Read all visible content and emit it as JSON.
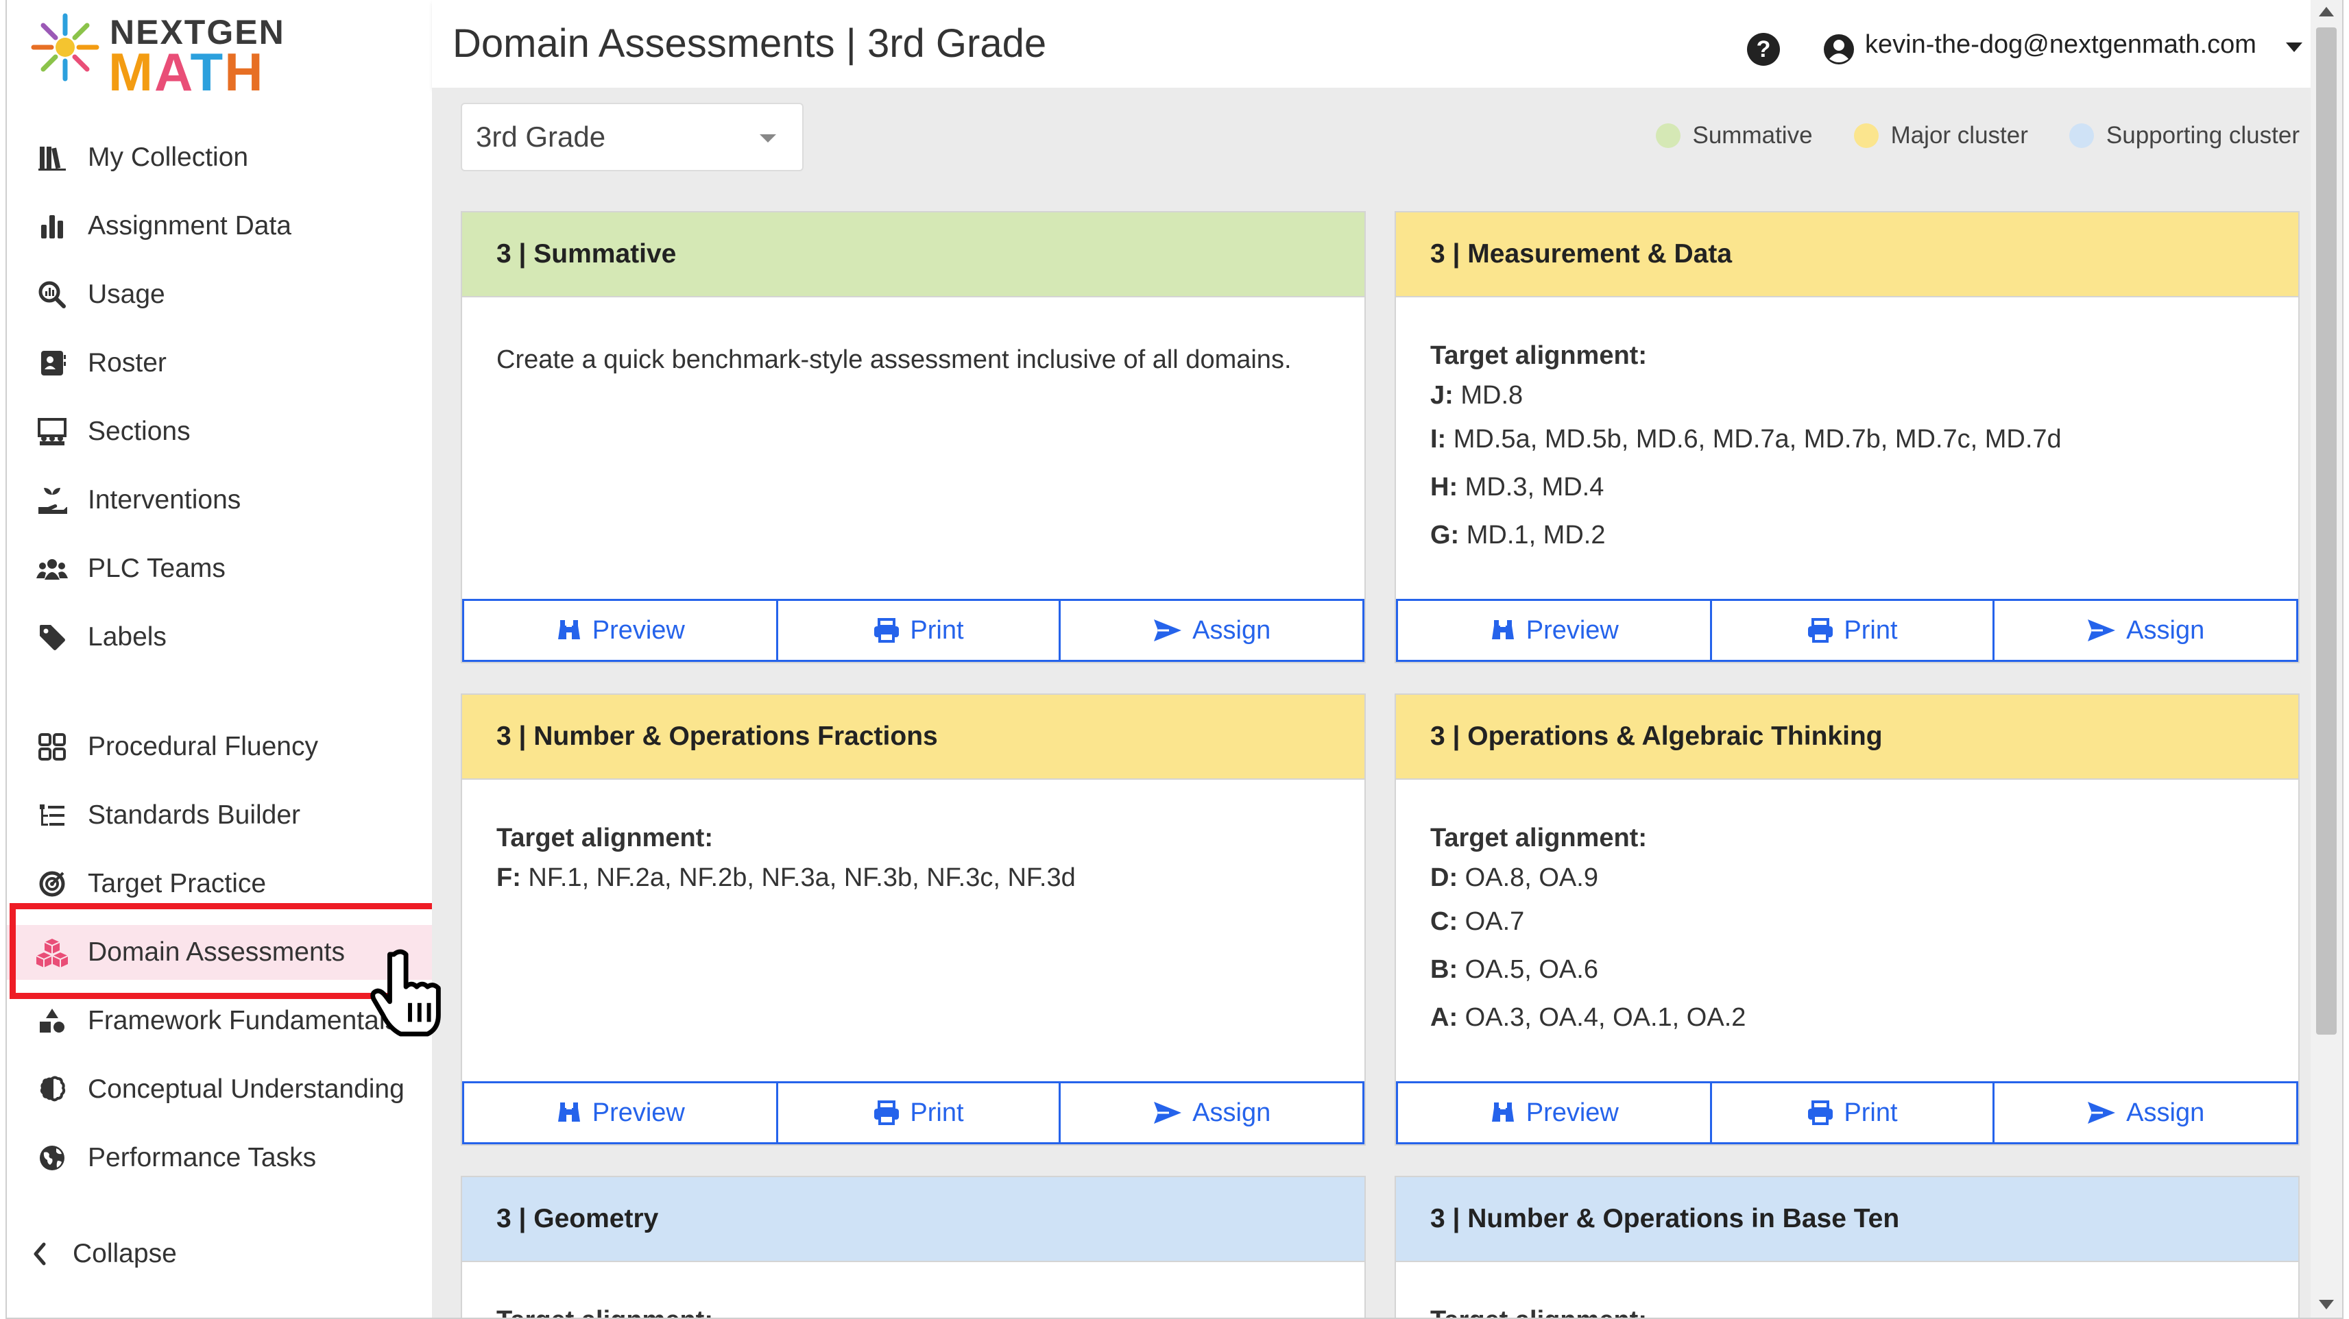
{
  "logo": {
    "top": "NEXTGEN",
    "m": "M",
    "a": "A",
    "t": "T",
    "h": "H"
  },
  "header": {
    "title": "Domain Assessments | 3rd Grade",
    "user_email": "kevin-the-dog@nextgenmath.com",
    "help_glyph": "?"
  },
  "sidebar": {
    "items": [
      {
        "label": "My Collection",
        "icon": "library-icon"
      },
      {
        "label": "Assignment Data",
        "icon": "bar-chart-icon"
      },
      {
        "label": "Usage",
        "icon": "magnify-chart-icon"
      },
      {
        "label": "Roster",
        "icon": "id-card-icon"
      },
      {
        "label": "Sections",
        "icon": "chalkboard-users-icon"
      },
      {
        "label": "Interventions",
        "icon": "hand-seedling-icon"
      },
      {
        "label": "PLC Teams",
        "icon": "users-icon"
      },
      {
        "label": "Labels",
        "icon": "tag-icon"
      },
      {
        "label": "Procedural Fluency",
        "icon": "grid-icon"
      },
      {
        "label": "Standards Builder",
        "icon": "list-tree-icon"
      },
      {
        "label": "Target Practice",
        "icon": "bullseye-icon"
      },
      {
        "label": "Domain Assessments",
        "icon": "cubes-icon"
      },
      {
        "label": "Framework Fundamentals",
        "icon": "shapes-icon"
      },
      {
        "label": "Conceptual Understanding",
        "icon": "brain-icon"
      },
      {
        "label": "Performance Tasks",
        "icon": "globe-icon"
      }
    ],
    "collapse_label": "Collapse"
  },
  "grade_select": {
    "value": "3rd Grade"
  },
  "legend": [
    {
      "label": "Summative",
      "color": "#d5e8b5"
    },
    {
      "label": "Major cluster",
      "color": "#fbe58e"
    },
    {
      "label": "Supporting cluster",
      "color": "#cfe2f6"
    }
  ],
  "buttons": {
    "preview": "Preview",
    "print": "Print",
    "assign": "Assign"
  },
  "cards": [
    {
      "title": "3 | Summative",
      "description": "Create a quick benchmark-style assessment inclusive of all domains."
    },
    {
      "title": "3 | Measurement & Data",
      "target_label": "Target alignment:",
      "targets": [
        {
          "key": "J:",
          "value": " MD.8"
        },
        {
          "key": "I:",
          "value": " MD.5a, MD.5b, MD.6, MD.7a, MD.7b, MD.7c, MD.7d"
        },
        {
          "key": "H:",
          "value": " MD.3, MD.4"
        },
        {
          "key": "G:",
          "value": " MD.1, MD.2"
        }
      ]
    },
    {
      "title": "3 | Number & Operations Fractions",
      "target_label": "Target alignment:",
      "targets": [
        {
          "key": "F:",
          "value": " NF.1, NF.2a, NF.2b, NF.3a, NF.3b, NF.3c, NF.3d"
        }
      ]
    },
    {
      "title": "3 | Operations & Algebraic Thinking",
      "target_label": "Target alignment:",
      "targets": [
        {
          "key": "D:",
          "value": " OA.8, OA.9"
        },
        {
          "key": "C:",
          "value": " OA.7"
        },
        {
          "key": "B:",
          "value": " OA.5, OA.6"
        },
        {
          "key": "A:",
          "value": " OA.3, OA.4, OA.1, OA.2"
        }
      ]
    },
    {
      "title": "3 | Geometry",
      "target_label": "Target alignment:"
    },
    {
      "title": "3 | Number & Operations in Base Ten",
      "target_label": "Target alignment:"
    }
  ]
}
